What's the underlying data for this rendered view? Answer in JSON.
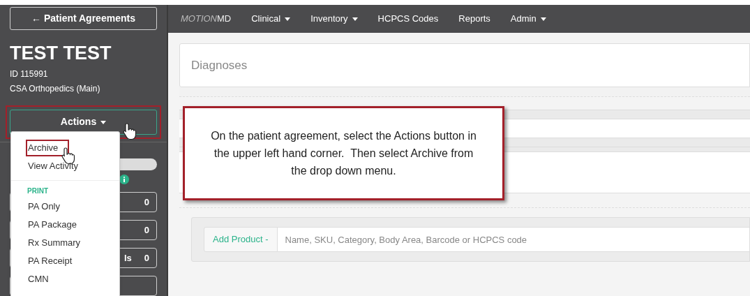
{
  "sidebar": {
    "back_button": "← Patient Agreements",
    "patient": {
      "name": "TEST TEST",
      "id": "ID 115991",
      "location": "CSA Orthopedics (Main)"
    },
    "actions_button": {
      "label": "Actions",
      "annotated": true
    },
    "counters": [
      {
        "count": "0"
      },
      {
        "count": "0"
      },
      {
        "label": "ls",
        "count": "0"
      }
    ]
  },
  "actions_menu": [
    {
      "kind": "item",
      "label": "Archive",
      "annotated": true
    },
    {
      "kind": "item",
      "label": "View Activity",
      "annotated": false
    },
    {
      "kind": "divider"
    },
    {
      "kind": "heading",
      "label": "PRINT"
    },
    {
      "kind": "item",
      "label": "PA Only",
      "annotated": false
    },
    {
      "kind": "item",
      "label": "PA Package",
      "annotated": false
    },
    {
      "kind": "item",
      "label": "Rx Summary",
      "annotated": false
    },
    {
      "kind": "item",
      "label": "PA Receipt",
      "annotated": false
    },
    {
      "kind": "item",
      "label": "CMN",
      "annotated": false
    }
  ],
  "navbar": {
    "brand": {
      "light": "MOTION",
      "bold": "MD"
    },
    "items": [
      {
        "label": "Clinical",
        "dropdown": true
      },
      {
        "label": "Inventory",
        "dropdown": true
      },
      {
        "label": "HCPCS Codes",
        "dropdown": false
      },
      {
        "label": "Reports",
        "dropdown": false
      },
      {
        "label": "Admin",
        "dropdown": true
      }
    ]
  },
  "content": {
    "section_title": "Diagnoses",
    "add_product": {
      "label": "Add Product -",
      "placeholder": "Name, SKU, Category, Body Area, Barcode or HCPCS code"
    }
  },
  "callout": "On the patient agreement, select the Actions button in the upper left hand corner.  Then select Archive from the drop down menu."
}
